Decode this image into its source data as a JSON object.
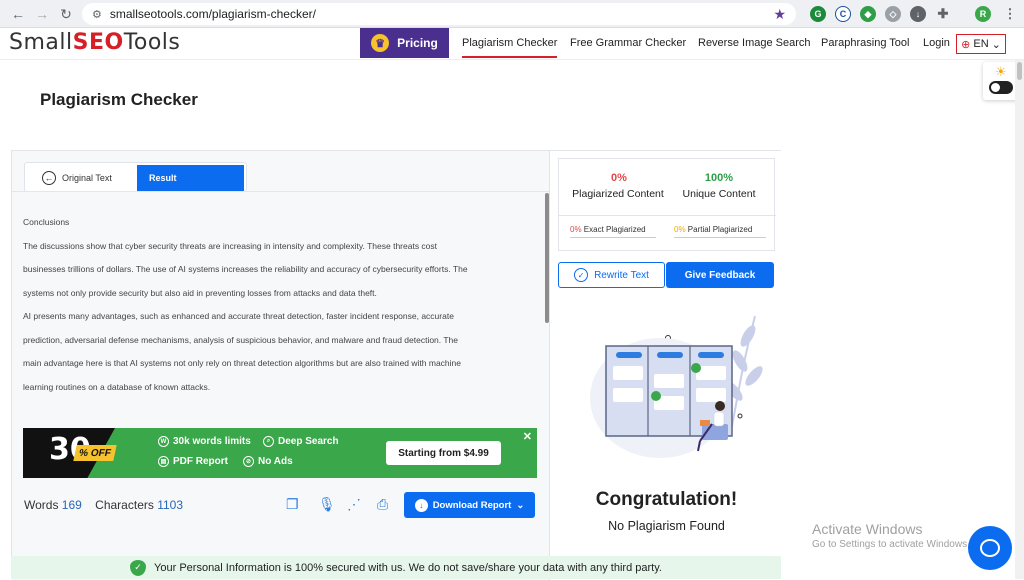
{
  "browser": {
    "url": "smallseotools.com/plagiarism-checker/",
    "profile_initial": "R"
  },
  "header": {
    "logo_prefix": "Small",
    "logo_seo": "SEO",
    "logo_suffix": "Tools",
    "pricing_label": "Pricing",
    "nav": [
      "Plagiarism Checker",
      "Free Grammar Checker",
      "Reverse Image Search",
      "Paraphrasing Tool",
      "Login"
    ],
    "language": "EN"
  },
  "page": {
    "title": "Plagiarism Checker"
  },
  "tabs": {
    "original": "Original Text",
    "result": "Result"
  },
  "text_lines": [
    "Conclusions",
    "The discussions show that cyber security threats are increasing in intensity and complexity. These threats cost",
    "businesses trillions of dollars. The use of AI systems increases the reliability and accuracy of cybersecurity efforts. The",
    "systems not only provide security but also aid in preventing losses from attacks and data theft.",
    "AI presents many advantages, such as enhanced and accurate threat detection, faster incident response, accurate",
    "prediction, adversarial defense mechanisms, analysis of suspicious behavior, and malware and fraud detection. The",
    "main advantage here is that AI systems not only rely on threat detection algorithms but are also trained with machine",
    "learning routines on a database of known attacks."
  ],
  "ad": {
    "big_number": "30",
    "off": "% OFF",
    "features": [
      "30k words limits",
      "Deep Search",
      "PDF Report",
      "No Ads"
    ],
    "cta": "Starting from $4.99"
  },
  "counts": {
    "words_label": "Words",
    "words": "169",
    "characters_label": "Characters",
    "characters": "1103"
  },
  "download_label": "Download Report",
  "results": {
    "plagiarized_pct": "0%",
    "plagiarized_label": "Plagiarized Content",
    "unique_pct": "100%",
    "unique_label": "Unique Content",
    "exact_pct": "0%",
    "exact_label": "Exact Plagiarized",
    "partial_pct": "0%",
    "partial_label": "Partial Plagiarized",
    "rewrite_label": "Rewrite Text",
    "feedback_label": "Give Feedback",
    "congrats": "Congratulation!",
    "message": "No Plagiarism Found"
  },
  "secure_message": "Your Personal Information is 100% secured with us. We do not save/share your data with any third party.",
  "windows": {
    "line1": "Activate Windows",
    "line2": "Go to Settings to activate Windows."
  },
  "colors": {
    "accent_blue": "#0b6cf0",
    "pricing_purple": "#4a2f8f",
    "brand_red": "#d61f26",
    "ad_green": "#3aa84a",
    "unique_green": "#2e9e47",
    "plag_red": "#e04848"
  }
}
